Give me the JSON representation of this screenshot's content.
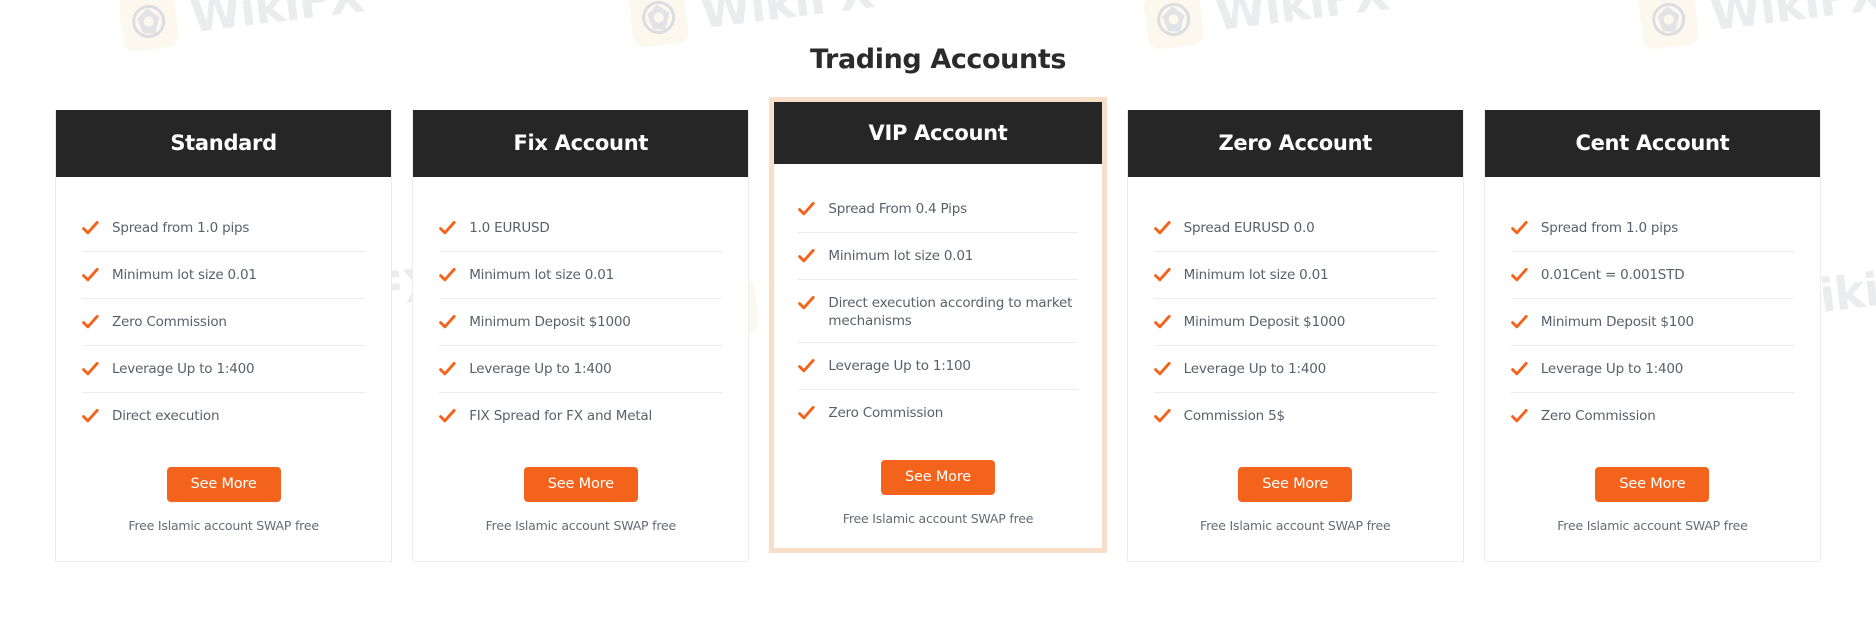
{
  "page": {
    "title": "Trading Accounts",
    "accent_color": "#f4631b",
    "header_bg": "#262626",
    "featured_border_color": "#fadfc8"
  },
  "watermark": {
    "text": "WikiFX",
    "icon": "wikifx-logo-icon"
  },
  "cards": [
    {
      "id": "standard",
      "title": "Standard",
      "featured": false,
      "features": [
        "Spread from 1.0 pips",
        "Minimum lot size 0.01",
        "Zero Commission",
        "Leverage Up to 1:400",
        "Direct execution"
      ],
      "cta_label": "See More",
      "note": "Free Islamic account SWAP free"
    },
    {
      "id": "fix-account",
      "title": "Fix Account",
      "featured": false,
      "features": [
        "1.0 EURUSD",
        "Minimum lot size 0.01",
        "Minimum Deposit $1000",
        "Leverage Up to 1:400",
        "FIX Spread for FX and Metal"
      ],
      "cta_label": "See More",
      "note": "Free Islamic account SWAP free"
    },
    {
      "id": "vip-account",
      "title": "VIP Account",
      "featured": true,
      "features": [
        "Spread From 0.4 Pips",
        "Minimum lot size 0.01",
        "Direct execution according to market mechanisms",
        "Leverage Up to 1:100",
        "Zero Commission"
      ],
      "cta_label": "See More",
      "note": "Free Islamic account SWAP free"
    },
    {
      "id": "zero-account",
      "title": "Zero Account",
      "featured": false,
      "features": [
        "Spread EURUSD 0.0",
        "Minimum lot size 0.01",
        "Minimum Deposit $1000",
        "Leverage Up to 1:400",
        "Commission 5$"
      ],
      "cta_label": "See More",
      "note": "Free Islamic account SWAP free"
    },
    {
      "id": "cent-account",
      "title": "Cent Account",
      "featured": false,
      "features": [
        "Spread from 1.0 pips",
        "0.01Cent = 0.001STD",
        "Minimum Deposit $100",
        "Leverage Up to 1:400",
        "Zero Commission"
      ],
      "cta_label": "See More",
      "note": "Free Islamic account SWAP free"
    }
  ]
}
